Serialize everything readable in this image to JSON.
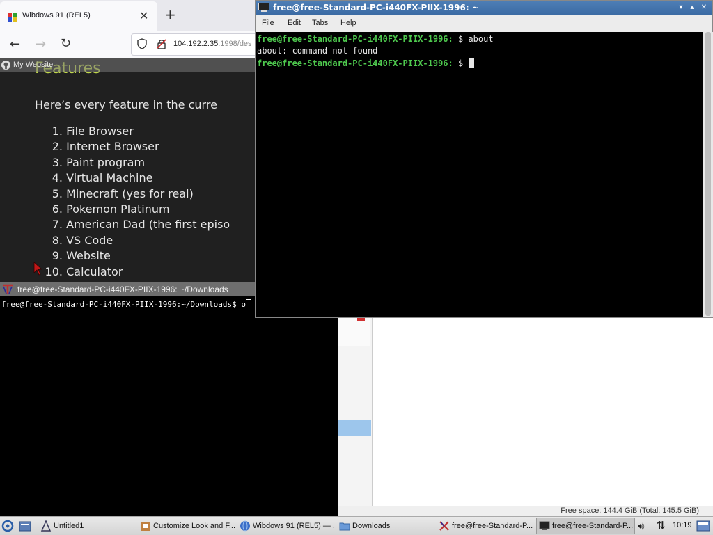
{
  "browser": {
    "tab_title": "Wibdows 91 (REL5)",
    "url_host": "104.192.2.35",
    "url_rest": ":1998/des",
    "bookmark": "My Website",
    "heading": "Features",
    "intro": "Here’s every feature in the curre",
    "features": [
      {
        "num": "1.",
        "text": "File Browser"
      },
      {
        "num": "2.",
        "text": "Internet Browser"
      },
      {
        "num": "3.",
        "text": "Paint program"
      },
      {
        "num": "4.",
        "text": "Virtual Machine"
      },
      {
        "num": "5.",
        "text": "Minecraft (yes for real)"
      },
      {
        "num": "6.",
        "text": "Pokemon Platinum"
      },
      {
        "num": "7.",
        "text": "American Dad (the first episo"
      },
      {
        "num": "8.",
        "text": "VS Code"
      },
      {
        "num": "9.",
        "text": "Website"
      },
      {
        "num": "10.",
        "text": "Calculator"
      }
    ]
  },
  "xterm": {
    "title": "free@free-Standard-PC-i440FX-PIIX-1996: ~/Downloads",
    "prompt": "free@free-Standard-PC-i440FX-PIIX-1996:~/Downloads$ o"
  },
  "filemgr": {
    "status": "Free space: 144.4 GiB (Total: 145.5 GiB)"
  },
  "lxterm": {
    "title": "free@free-Standard-PC-i440FX-PIIX-1996: ~",
    "menu": [
      "File",
      "Edit",
      "Tabs",
      "Help"
    ],
    "lines": [
      {
        "prompt": "free@free-Standard-PC-i440FX-PIIX-1996:",
        "rest": " $ about"
      },
      {
        "prompt": "",
        "rest": "about: command not found"
      },
      {
        "prompt": "free@free-Standard-PC-i440FX-PIIX-1996:",
        "rest": " $ "
      }
    ]
  },
  "taskbar": {
    "items": [
      {
        "label": "Untitled1"
      },
      {
        "label": "Customize Look and F..."
      },
      {
        "label": "Wibdows 91 (REL5) — ..."
      },
      {
        "label": "Downloads"
      },
      {
        "label": "free@free-Standard-P..."
      },
      {
        "label": "free@free-Standard-P..."
      }
    ],
    "clock": "10:19"
  },
  "colors": {
    "terminal_green": "#4ec94e",
    "titlebar_blue": "#3a6aa3",
    "heading_yellow": "#c2d94c"
  }
}
